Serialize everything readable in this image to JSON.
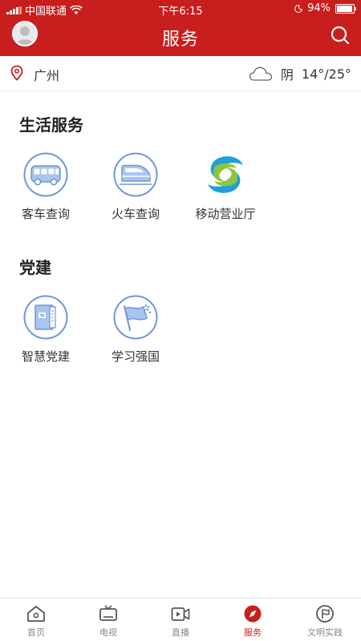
{
  "status_bar": {
    "carrier": "中国联通",
    "time": "下午6:15",
    "battery": "94%",
    "battery_level": 0.94
  },
  "header": {
    "title": "服务"
  },
  "location": {
    "city": "广州",
    "weather": "阴",
    "temperature": "14°/25°"
  },
  "sections": [
    {
      "title": "生活服务",
      "items": [
        {
          "label": "客车查询",
          "icon": "bus-icon"
        },
        {
          "label": "火车查询",
          "icon": "train-icon"
        },
        {
          "label": "移动营业厅",
          "icon": "china-mobile-logo"
        }
      ]
    },
    {
      "title": "党建",
      "items": [
        {
          "label": "智慧党建",
          "icon": "party-book-icon"
        },
        {
          "label": "学习强国",
          "icon": "flag-icon"
        }
      ]
    }
  ],
  "tab_bar": {
    "active": "服务",
    "tabs": [
      {
        "label": "首页",
        "icon": "home-icon"
      },
      {
        "label": "电视",
        "icon": "tv-icon"
      },
      {
        "label": "直播",
        "icon": "live-video-icon"
      },
      {
        "label": "服务",
        "icon": "compass-icon"
      },
      {
        "label": "文明实践",
        "icon": "flag-circle-icon"
      }
    ]
  },
  "colors": {
    "brand_red": "#c81e1e",
    "icon_blue": "#6f97d6",
    "tab_inactive": "#888888"
  }
}
